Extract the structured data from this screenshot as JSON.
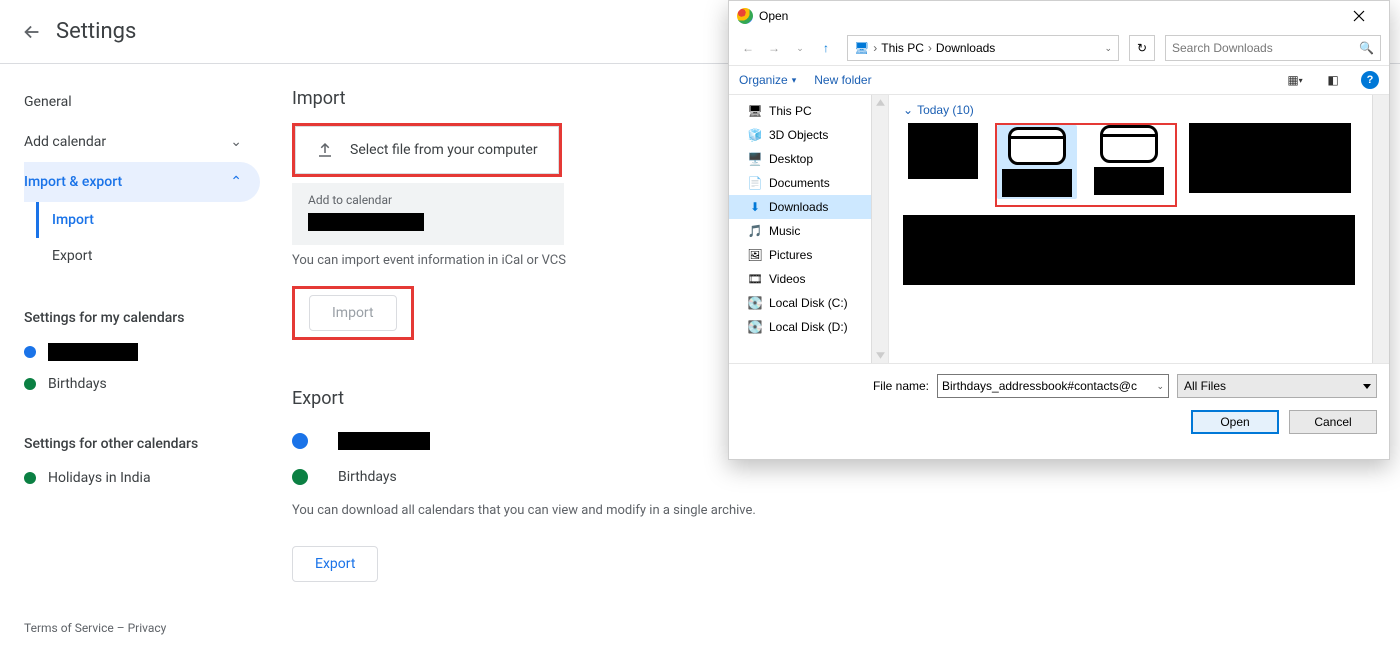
{
  "appbar": {
    "title": "Settings"
  },
  "sidebar": {
    "general": "General",
    "add_calendar": "Add calendar",
    "import_export": "Import & export",
    "import": "Import",
    "export": "Export",
    "settings_for_my": "Settings for my calendars",
    "birthdays": "Birthdays",
    "settings_for_other": "Settings for other calendars",
    "holidays": "Holidays in India"
  },
  "footer": {
    "terms": "Terms of Service",
    "dash": " – ",
    "privacy": "Privacy"
  },
  "main": {
    "import_title": "Import",
    "select_file": "Select file from your computer",
    "add_to_calendar": "Add to calendar",
    "hint": "You can import event information in iCal or VCS",
    "import_btn": "Import",
    "export_title": "Export",
    "exp_birthdays": "Birthdays",
    "export_hint": "You can download all calendars that you can view and modify in a single archive.",
    "export_btn": "Export"
  },
  "colors": {
    "blue": "#1a73e8",
    "green": "#0b8043",
    "darkgreen": "#0b8043"
  },
  "dialog": {
    "title": "Open",
    "path": {
      "root": "This PC",
      "leaf": "Downloads"
    },
    "search_placeholder": "Search Downloads",
    "organize": "Organize",
    "new_folder": "New folder",
    "tree": {
      "this_pc": "This PC",
      "objects3d": "3D Objects",
      "desktop": "Desktop",
      "documents": "Documents",
      "downloads": "Downloads",
      "music": "Music",
      "pictures": "Pictures",
      "videos": "Videos",
      "local_c": "Local Disk (C:)",
      "local_d": "Local Disk (D:)"
    },
    "group": {
      "today": "Today (10)"
    },
    "file_name_label": "File name:",
    "file_name_value": "Birthdays_addressbook#contacts@c",
    "filter": "All Files",
    "open": "Open",
    "cancel": "Cancel"
  }
}
